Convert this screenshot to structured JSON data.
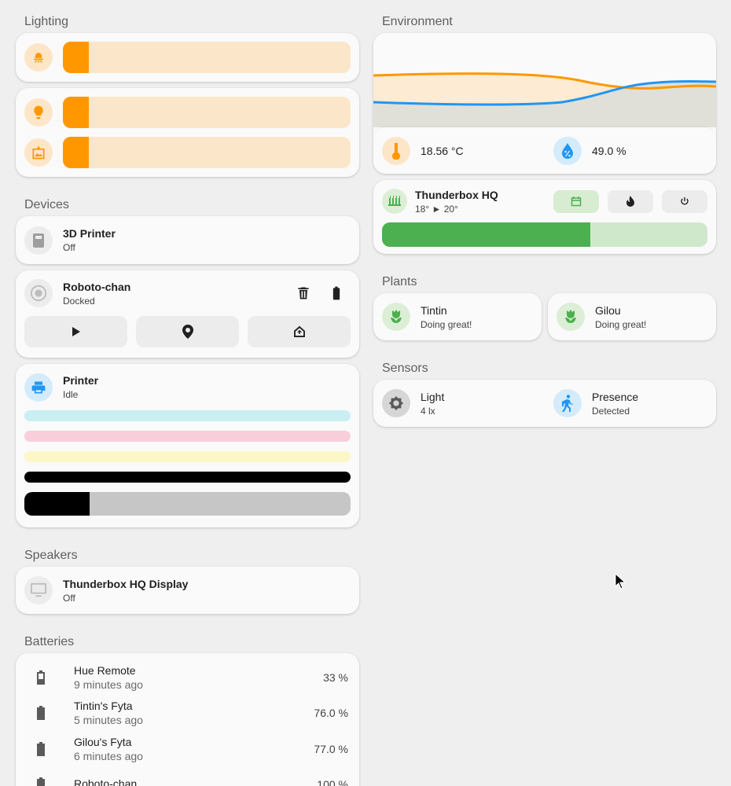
{
  "sections": {
    "lighting": "Lighting",
    "devices": "Devices",
    "speakers": "Speakers",
    "batteries": "Batteries",
    "environment": "Environment",
    "plants": "Plants",
    "sensors": "Sensors"
  },
  "lighting": {
    "sliders": [
      {
        "icon": "ceiling-light-icon",
        "level": 0.09
      },
      {
        "icon": "lightbulb-icon",
        "level": 0.09
      },
      {
        "icon": "picture-frame-light-icon",
        "level": 0.09
      }
    ]
  },
  "devices": {
    "printer3d": {
      "name": "3D Printer",
      "state": "Off",
      "icon": "3d-printer-icon"
    },
    "vacuum": {
      "name": "Roboto-chan",
      "state": "Docked",
      "icon": "robot-vacuum-icon",
      "actions": [
        "delete-icon",
        "battery-icon"
      ],
      "buttons": [
        "play-icon",
        "locate-icon",
        "return-home-icon"
      ]
    },
    "printer": {
      "name": "Printer",
      "state": "Idle",
      "icon": "printer-icon",
      "ink_levels": [
        {
          "color": "#c9eff3",
          "level": 1.0
        },
        {
          "color": "#f8cedb",
          "level": 1.0
        },
        {
          "color": "#fdf6c9",
          "level": 1.0
        },
        {
          "color": "#000000",
          "level": 1.0
        },
        {
          "color": "#000000",
          "level": 0.2
        }
      ]
    }
  },
  "speakers": {
    "display": {
      "name": "Thunderbox HQ Display",
      "state": "Off",
      "icon": "monitor-icon"
    }
  },
  "batteries": [
    {
      "name": "Hue Remote",
      "time": "9 minutes ago",
      "value": "33 %"
    },
    {
      "name": "Tintin's Fyta",
      "time": "5 minutes ago",
      "value": "76.0 %"
    },
    {
      "name": "Gilou's Fyta",
      "time": "6 minutes ago",
      "value": "77.0 %"
    },
    {
      "name": "Roboto-chan",
      "time": "",
      "value": "100 %"
    }
  ],
  "environment": {
    "temperature": "18.56 °C",
    "humidity": "49.0 %",
    "colors": {
      "temperature": "#ff9800",
      "humidity": "#2196f3"
    }
  },
  "thermostat": {
    "name": "Thunderbox HQ",
    "range": "18° ► 20°",
    "icon": "radiator-icon",
    "modes": [
      "calendar-icon",
      "fire-icon",
      "power-icon"
    ],
    "progress": 0.64,
    "color": "#4caf50"
  },
  "plants": [
    {
      "name": "Tintin",
      "state": "Doing great!"
    },
    {
      "name": "Gilou",
      "state": "Doing great!"
    }
  ],
  "sensors": [
    {
      "name": "Light",
      "state": "4 lx",
      "icon": "brightness-icon"
    },
    {
      "name": "Presence",
      "state": "Detected",
      "icon": "walk-icon"
    }
  ]
}
